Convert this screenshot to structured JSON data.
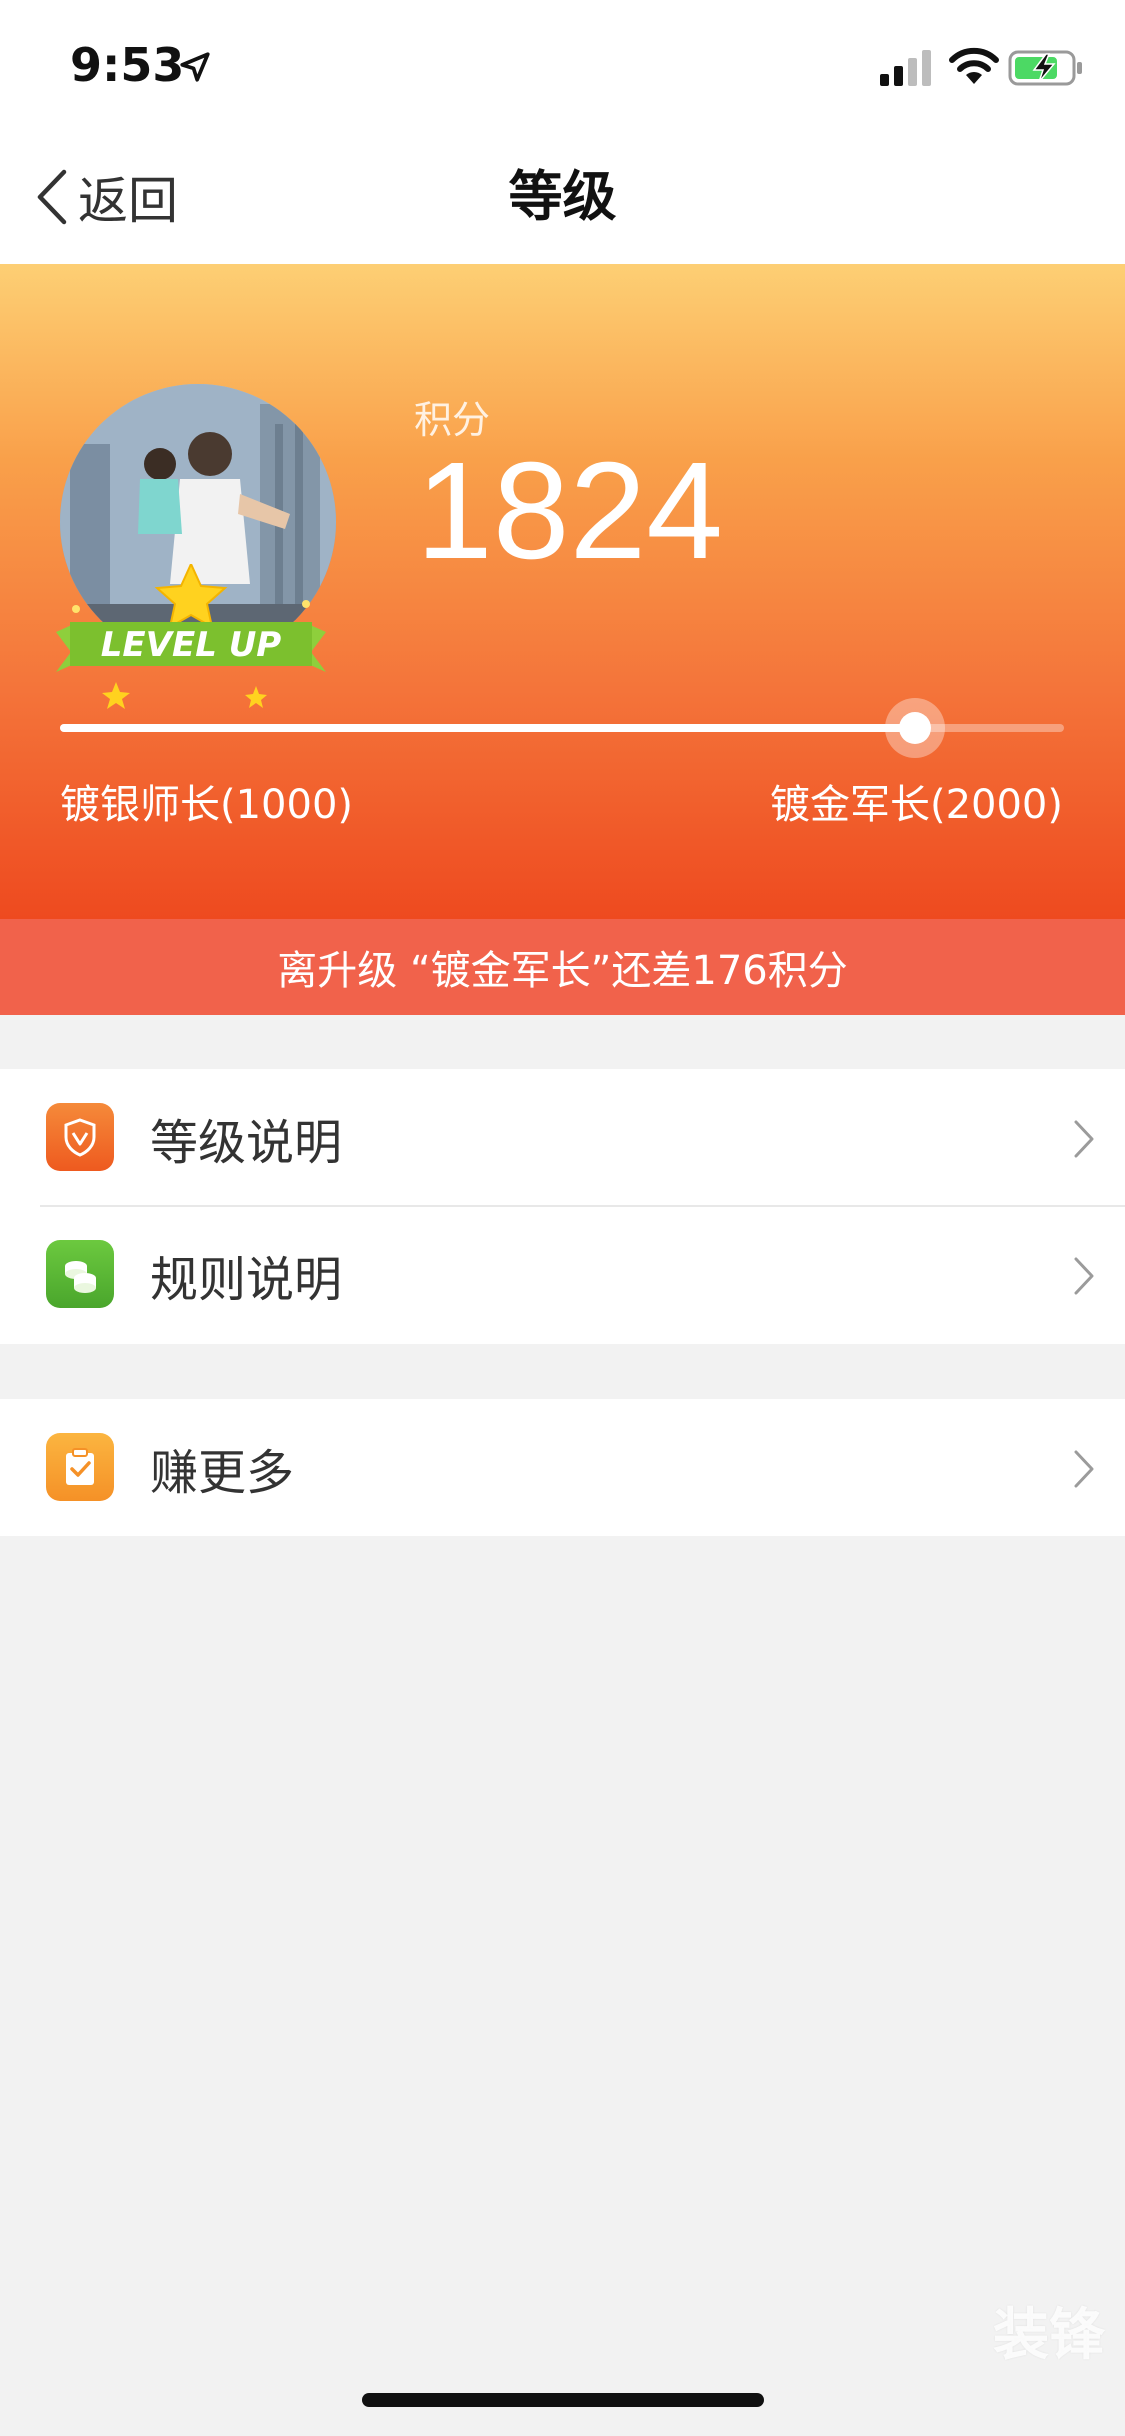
{
  "status_bar": {
    "time": "9:53"
  },
  "nav": {
    "back_label": "返回",
    "title": "等级"
  },
  "level": {
    "points_label": "积分",
    "points_value": "1824",
    "badge_text": "LEVEL UP",
    "range_start_label": "镀银师长(1000)",
    "range_end_label": "镀金军长(2000)",
    "range_min": 1000,
    "range_max": 2000,
    "current_points": 1824,
    "progress_fraction": 0.852,
    "upgrade_banner": "离升级 “镀金军长”还差176积分"
  },
  "menu_group_1": [
    {
      "label": "等级说明",
      "icon": "shield-icon"
    },
    {
      "label": "规则说明",
      "icon": "coins-icon"
    }
  ],
  "menu_group_2": [
    {
      "label": "赚更多",
      "icon": "clipboard-check-icon"
    }
  ],
  "watermark": "装锋",
  "colors": {
    "gradient_top": "#fdcf74",
    "gradient_bottom": "#ee4a1f",
    "banner": "#f1624b",
    "shield_icon_bg": "#f06a2b",
    "coins_icon_bg": "#5fba3a",
    "clipboard_icon_bg": "#f7a534"
  }
}
